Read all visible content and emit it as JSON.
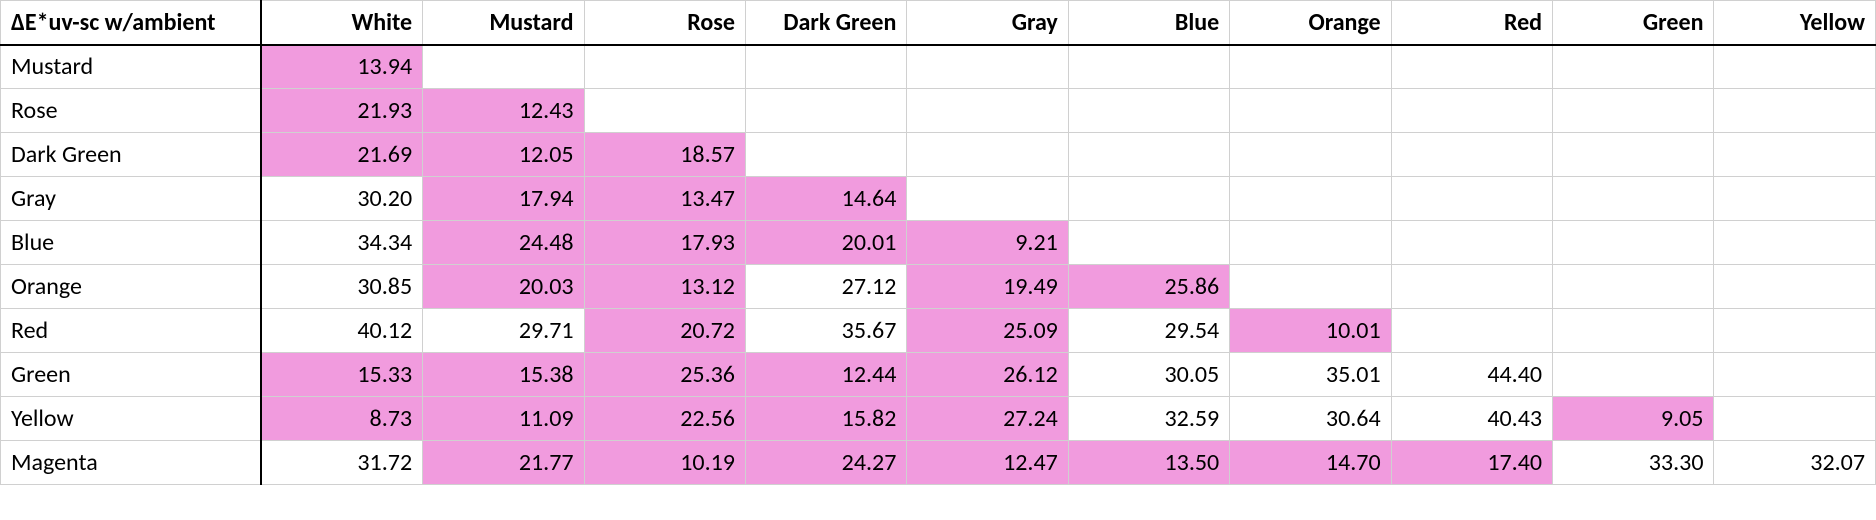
{
  "title": "ΔE*uv-sc w/ambient",
  "columns": [
    "White",
    "Mustard",
    "Rose",
    "Dark Green",
    "Gray",
    "Blue",
    "Orange",
    "Red",
    "Green",
    "Yellow"
  ],
  "rows": [
    {
      "label": "Mustard",
      "cells": [
        {
          "v": "13.94",
          "hl": true
        }
      ]
    },
    {
      "label": "Rose",
      "cells": [
        {
          "v": "21.93",
          "hl": true
        },
        {
          "v": "12.43",
          "hl": true
        }
      ]
    },
    {
      "label": "Dark Green",
      "cells": [
        {
          "v": "21.69",
          "hl": true
        },
        {
          "v": "12.05",
          "hl": true
        },
        {
          "v": "18.57",
          "hl": true
        }
      ]
    },
    {
      "label": "Gray",
      "cells": [
        {
          "v": "30.20",
          "hl": false
        },
        {
          "v": "17.94",
          "hl": true
        },
        {
          "v": "13.47",
          "hl": true
        },
        {
          "v": "14.64",
          "hl": true
        }
      ]
    },
    {
      "label": "Blue",
      "cells": [
        {
          "v": "34.34",
          "hl": false
        },
        {
          "v": "24.48",
          "hl": true
        },
        {
          "v": "17.93",
          "hl": true
        },
        {
          "v": "20.01",
          "hl": true
        },
        {
          "v": "9.21",
          "hl": true
        }
      ]
    },
    {
      "label": "Orange",
      "cells": [
        {
          "v": "30.85",
          "hl": false
        },
        {
          "v": "20.03",
          "hl": true
        },
        {
          "v": "13.12",
          "hl": true
        },
        {
          "v": "27.12",
          "hl": false
        },
        {
          "v": "19.49",
          "hl": true
        },
        {
          "v": "25.86",
          "hl": true
        }
      ]
    },
    {
      "label": "Red",
      "cells": [
        {
          "v": "40.12",
          "hl": false
        },
        {
          "v": "29.71",
          "hl": false
        },
        {
          "v": "20.72",
          "hl": true
        },
        {
          "v": "35.67",
          "hl": false
        },
        {
          "v": "25.09",
          "hl": true
        },
        {
          "v": "29.54",
          "hl": false
        },
        {
          "v": "10.01",
          "hl": true
        }
      ]
    },
    {
      "label": "Green",
      "cells": [
        {
          "v": "15.33",
          "hl": true
        },
        {
          "v": "15.38",
          "hl": true
        },
        {
          "v": "25.36",
          "hl": true
        },
        {
          "v": "12.44",
          "hl": true
        },
        {
          "v": "26.12",
          "hl": true
        },
        {
          "v": "30.05",
          "hl": false
        },
        {
          "v": "35.01",
          "hl": false
        },
        {
          "v": "44.40",
          "hl": false
        }
      ]
    },
    {
      "label": "Yellow",
      "cells": [
        {
          "v": "8.73",
          "hl": true
        },
        {
          "v": "11.09",
          "hl": true
        },
        {
          "v": "22.56",
          "hl": true
        },
        {
          "v": "15.82",
          "hl": true
        },
        {
          "v": "27.24",
          "hl": true
        },
        {
          "v": "32.59",
          "hl": false
        },
        {
          "v": "30.64",
          "hl": false
        },
        {
          "v": "40.43",
          "hl": false
        },
        {
          "v": "9.05",
          "hl": true
        }
      ]
    },
    {
      "label": "Magenta",
      "cells": [
        {
          "v": "31.72",
          "hl": false
        },
        {
          "v": "21.77",
          "hl": true
        },
        {
          "v": "10.19",
          "hl": true
        },
        {
          "v": "24.27",
          "hl": true
        },
        {
          "v": "12.47",
          "hl": true
        },
        {
          "v": "13.50",
          "hl": true
        },
        {
          "v": "14.70",
          "hl": true
        },
        {
          "v": "17.40",
          "hl": true
        },
        {
          "v": "33.30",
          "hl": false
        },
        {
          "v": "32.07",
          "hl": false
        }
      ]
    }
  ],
  "highlight_color": "#f19bde"
}
